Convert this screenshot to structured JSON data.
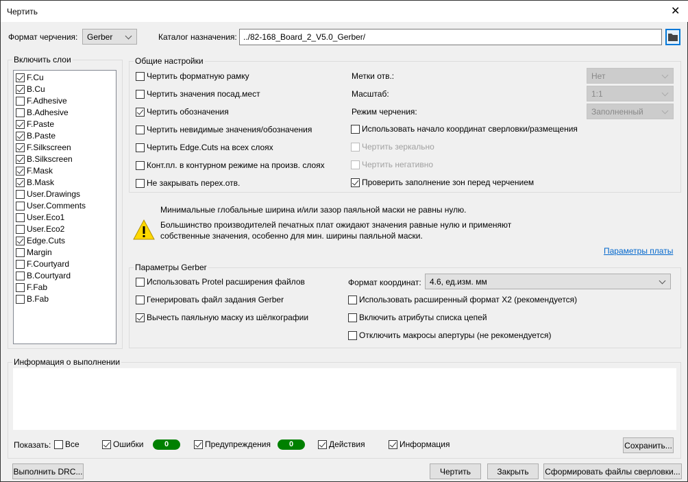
{
  "window": {
    "title": "Чертить",
    "close": "✕"
  },
  "top": {
    "format_label": "Формат черчения:",
    "format_value": "Gerber",
    "dir_label": "Каталог назначения:",
    "dir_value": "../82-168_Board_2_V5.0_Gerber/"
  },
  "layers": {
    "title": "Включить слои",
    "items": [
      {
        "label": "F.Cu",
        "checked": true
      },
      {
        "label": "B.Cu",
        "checked": true
      },
      {
        "label": "F.Adhesive",
        "checked": false
      },
      {
        "label": "B.Adhesive",
        "checked": false
      },
      {
        "label": "F.Paste",
        "checked": true
      },
      {
        "label": "B.Paste",
        "checked": true
      },
      {
        "label": "F.Silkscreen",
        "checked": true
      },
      {
        "label": "B.Silkscreen",
        "checked": true
      },
      {
        "label": "F.Mask",
        "checked": true
      },
      {
        "label": "B.Mask",
        "checked": true
      },
      {
        "label": "User.Drawings",
        "checked": false
      },
      {
        "label": "User.Comments",
        "checked": false
      },
      {
        "label": "User.Eco1",
        "checked": false
      },
      {
        "label": "User.Eco2",
        "checked": false
      },
      {
        "label": "Edge.Cuts",
        "checked": true
      },
      {
        "label": "Margin",
        "checked": false
      },
      {
        "label": "F.Courtyard",
        "checked": false
      },
      {
        "label": "B.Courtyard",
        "checked": false
      },
      {
        "label": "F.Fab",
        "checked": false
      },
      {
        "label": "B.Fab",
        "checked": false
      }
    ]
  },
  "general": {
    "title": "Общие настройки",
    "left": [
      {
        "label": "Чертить форматную рамку",
        "checked": false
      },
      {
        "label": "Чертить значения посад.мест",
        "checked": false
      },
      {
        "label": "Чертить обозначения",
        "checked": true
      },
      {
        "label": "Чертить невидимые значения/обозначения",
        "checked": false
      },
      {
        "label": "Чертить Edge.Cuts на всех слоях",
        "checked": false
      },
      {
        "label": "Конт.пл. в контурном режиме на произв. слоях",
        "checked": false
      },
      {
        "label": "Не закрывать перех.отв.",
        "checked": false
      }
    ],
    "drill_marks_label": "Метки отв.:",
    "drill_marks_value": "Нет",
    "scale_label": "Масштаб:",
    "scale_value": "1:1",
    "mode_label": "Режим черчения:",
    "mode_value": "Заполненный",
    "right": [
      {
        "label": "Использовать начало координат сверловки/размещения",
        "checked": false,
        "disabled": false
      },
      {
        "label": "Чертить зеркально",
        "checked": false,
        "disabled": true
      },
      {
        "label": "Чертить негативно",
        "checked": false,
        "disabled": true
      },
      {
        "label": "Проверить заполнение зон перед черчением",
        "checked": true,
        "disabled": false
      }
    ]
  },
  "warning": {
    "line1": "Минимальные глобальные ширина и/или зазор паяльной маски не равны нулю.",
    "line2": "Большинство производителей печатных плат ожидают значения равные нулю и применяют",
    "line3": "собственные значения, особенно для мин. ширины паяльной маски.",
    "link": "Параметры платы",
    "icon": "warning-icon"
  },
  "gerber": {
    "title": "Параметры Gerber",
    "left": [
      {
        "label": "Использовать Protel расширения файлов",
        "checked": false
      },
      {
        "label": "Генерировать файл задания Gerber",
        "checked": false
      },
      {
        "label": "Вычесть паяльную маску из шёлкографии",
        "checked": true
      }
    ],
    "coord_label": "Формат координат:",
    "coord_value": "4.6, ед.изм. мм",
    "right": [
      {
        "label": "Использовать расширенный формат X2 (рекомендуется)",
        "checked": false
      },
      {
        "label": "Включить атрибуты списка цепей",
        "checked": false
      },
      {
        "label": "Отключить макросы апертуры (не рекомендуется)",
        "checked": false
      }
    ]
  },
  "messages": {
    "title": "Информация о выполнении",
    "show_label": "Показать:",
    "all": "Все",
    "errors": "Ошибки",
    "errors_count": "0",
    "warnings": "Предупреждения",
    "warnings_count": "0",
    "actions": "Действия",
    "info": "Информация",
    "save": "Сохранить..."
  },
  "buttons": {
    "drc": "Выполнить DRC...",
    "plot": "Чертить",
    "close": "Закрыть",
    "drill": "Сформировать файлы сверловки..."
  },
  "colors": {
    "badge": "#008000",
    "link": "#0066cc",
    "accent": "#0078d7"
  }
}
